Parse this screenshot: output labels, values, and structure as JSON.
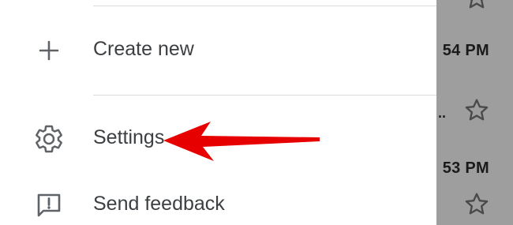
{
  "drawer": {
    "items": [
      {
        "label": "Create new",
        "icon": "plus-icon"
      },
      {
        "label": "Settings",
        "icon": "gear-icon"
      },
      {
        "label": "Send feedback",
        "icon": "feedback-icon"
      }
    ]
  },
  "background": {
    "times": [
      "54 PM",
      "53 PM"
    ],
    "ellipsis": "..",
    "star_icon": "star-outline-icon"
  },
  "annotation": {
    "arrow_color": "#e60000",
    "arrow_icon": "red-arrow-annotation"
  },
  "colors": {
    "dim_overlay": "#9e9e9e",
    "text": "#3c4043",
    "icon": "#5f6368",
    "divider": "#dadce0"
  }
}
